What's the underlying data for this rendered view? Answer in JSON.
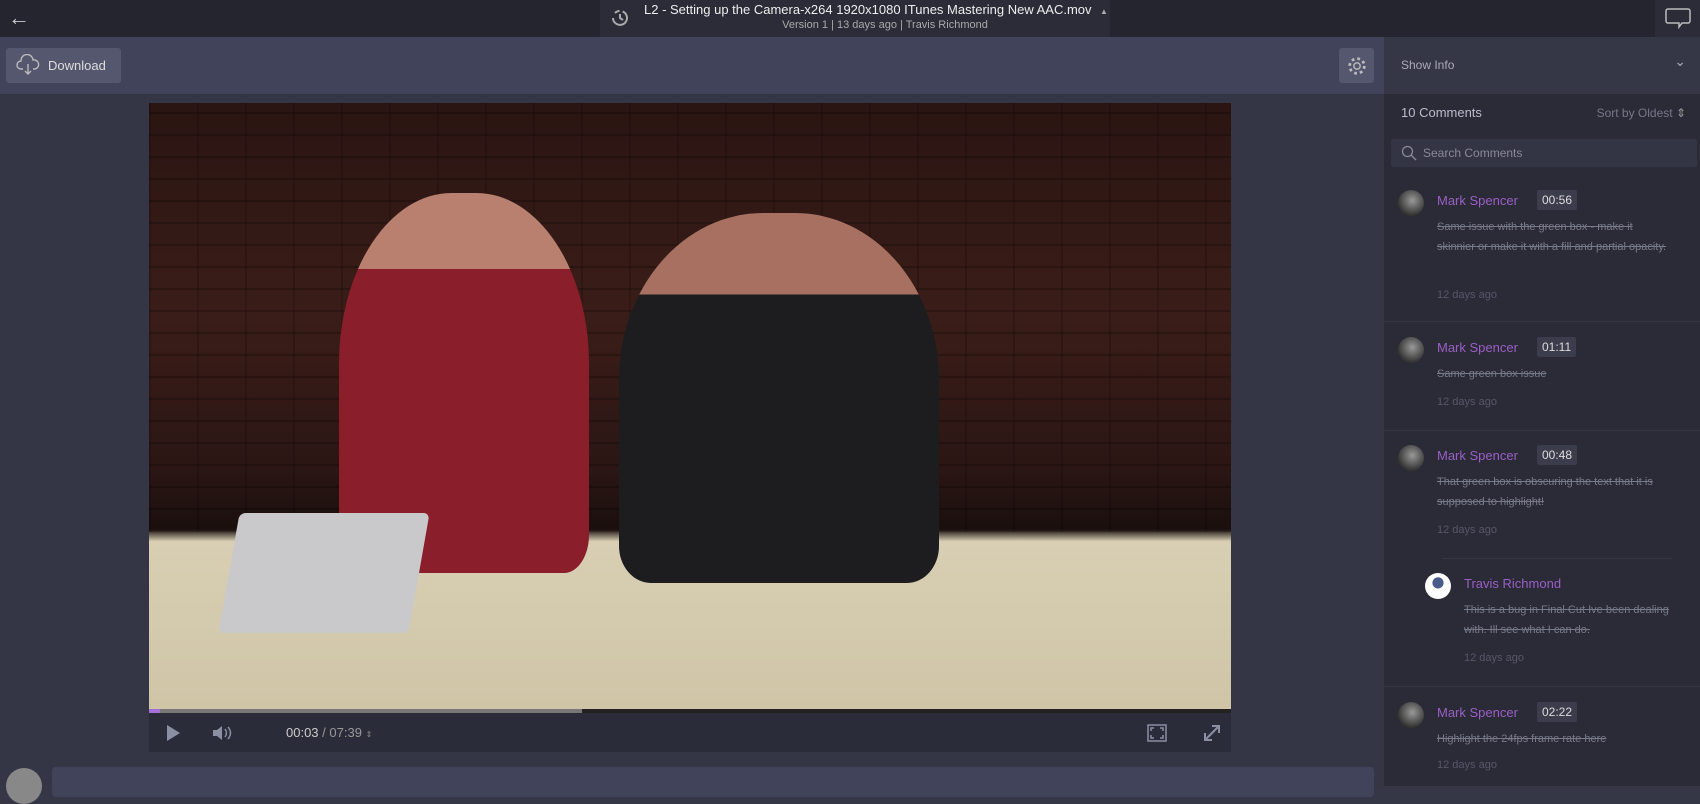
{
  "header": {
    "title": "L2 - Setting up the Camera-x264 1920x1080 ITunes Mastering New AAC.mov",
    "version": "Version 1",
    "age": "13 days ago",
    "author": "Travis Richmond",
    "separator": "|"
  },
  "toolbar": {
    "download_label": "Download"
  },
  "player": {
    "current_time": "00:03",
    "duration": "07:39",
    "time_separator": "/",
    "progress_percent": 0.65,
    "accent": "#a46fd6"
  },
  "sidebar": {
    "show_info": "Show Info",
    "comment_count": "10 Comments",
    "sort_label": "Sort by Oldest",
    "search_placeholder": "Search Comments",
    "comments": [
      {
        "author": "Mark Spencer",
        "timestamp": "00:56",
        "text": "Same issue with the green box - make it skinnier or make it with a fill and partial opacity.",
        "age": "12 days ago"
      },
      {
        "author": "Mark Spencer",
        "timestamp": "01:11",
        "text": "Same green box issue",
        "age": "12 days ago"
      },
      {
        "author": "Mark Spencer",
        "timestamp": "00:48",
        "text": "That green box is obscuring the text that it is supposed to highlight!",
        "age": "12 days ago"
      },
      {
        "author": "Travis Richmond",
        "text": "This is a bug in Final Cut Ive been dealing with. Ill see what I can do.",
        "age": "12 days ago"
      },
      {
        "author": "Mark Spencer",
        "timestamp": "02:22",
        "text": "Highlight the 24fps frame rate here",
        "age": "12 days ago"
      }
    ]
  },
  "colors": {
    "author": "#9a5fc4",
    "background": "#353645",
    "sidebar": "#2b2b38"
  }
}
